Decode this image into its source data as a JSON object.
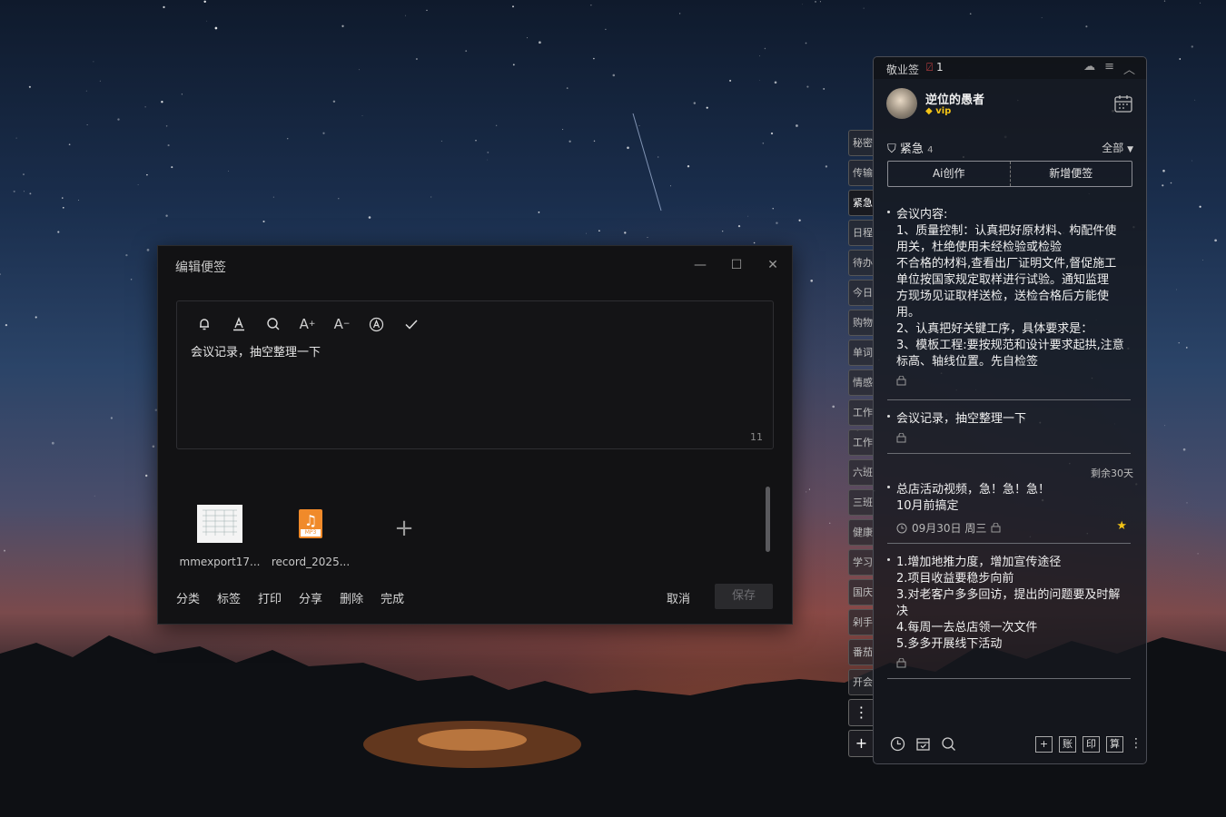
{
  "editor": {
    "title": "编辑便签",
    "window_controls": [
      "minimize-icon",
      "maximize-icon",
      "close-icon"
    ],
    "toolbar_icons": [
      "bell-icon",
      "text-color-icon",
      "search-icon",
      "font-increase-icon",
      "font-decrease-icon",
      "text-style-icon",
      "check-icon"
    ],
    "text": "会议记录，抽空整理一下",
    "char_count": "11",
    "attachments": [
      {
        "name": "mmexport17...",
        "type": "image"
      },
      {
        "name": "record_2025...",
        "type": "audio",
        "badge": "MP3"
      }
    ],
    "bottom_actions": [
      "分类",
      "标签",
      "打印",
      "分享",
      "删除",
      "完成"
    ],
    "cancel_label": "取消",
    "save_label": "保存"
  },
  "side_tabs": {
    "items": [
      "秘密",
      "传输",
      "紧急",
      "日程",
      "待办",
      "今日",
      "购物",
      "单词",
      "情感",
      "工作",
      "工作",
      "六班",
      "三班",
      "健康",
      "学习",
      "国庆",
      "剁手",
      "番茄",
      "开会"
    ],
    "active_index": 2,
    "more_icon": "more-vertical-icon",
    "add_icon": "plus-icon"
  },
  "panel": {
    "app_name": "敬业签",
    "notification_count": "1",
    "top_icons": [
      "cloud-sync-icon",
      "menu-icon",
      "collapse-icon"
    ],
    "user": {
      "name": "逆位的愚者",
      "vip": "vip"
    },
    "calendar_icon": "calendar-icon",
    "category": {
      "name": "紧急",
      "count": "4"
    },
    "filter": "全部",
    "ai_button": "Ai创作",
    "new_note_button": "新增便签",
    "notes": [
      {
        "lines": [
          "会议内容:",
          "1、质量控制：认真把好原材料、构配件使",
          "用关，杜绝使用未经检验或检验",
          "不合格的材料,查看出厂证明文件,督促施工",
          "单位按国家规定取样进行试验。通知监理",
          "方现场见证取样送检，送检合格后方能使",
          "用。",
          "2、认真把好关键工序，具体要求是：",
          "3、模板工程:要按规范和设计要求起拱,注意",
          "标高、轴线位置。先自检签"
        ]
      },
      {
        "lines": [
          "会议记录，抽空整理一下"
        ]
      },
      {
        "lines": [
          "总店活动视频，急！急！急！",
          "10月前搞定"
        ],
        "remaining": "剩余30天",
        "date": "09月30日 周三",
        "starred": true
      },
      {
        "lines": [
          "1.增加地推力度，增加宣传途径",
          "2.项目收益要稳步向前",
          "3.对老客户多多回访，提出的问题要及时解",
          "决",
          "4.每周一去总店领一次文件",
          "5.多多开展线下活动"
        ]
      }
    ],
    "bottom_icons": [
      "clock-icon",
      "calendar-box-icon",
      "search-icon"
    ],
    "bottom_buttons": [
      "+",
      "账",
      "印",
      "算"
    ]
  }
}
